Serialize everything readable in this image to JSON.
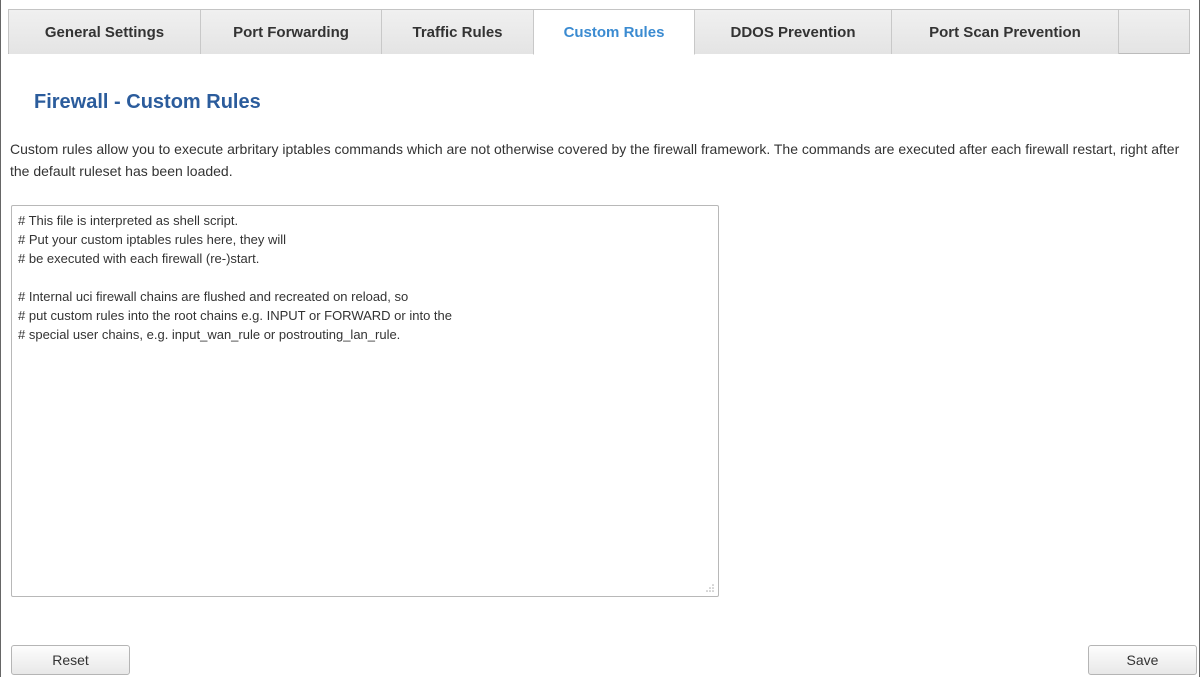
{
  "tabs": [
    {
      "label": "General Settings",
      "active": false
    },
    {
      "label": "Port Forwarding",
      "active": false
    },
    {
      "label": "Traffic Rules",
      "active": false
    },
    {
      "label": "Custom Rules",
      "active": true
    },
    {
      "label": "DDOS Prevention",
      "active": false
    },
    {
      "label": "Port Scan Prevention",
      "active": false
    }
  ],
  "page": {
    "title": "Firewall - Custom Rules",
    "description": "Custom rules allow you to execute arbritary iptables commands which are not otherwise covered by the firewall framework. The commands are executed after each firewall restart, right after the default ruleset has been loaded."
  },
  "editor": {
    "lines": [
      "# This file is interpreted as shell script.",
      "# Put your custom iptables rules here, they will",
      "# be executed with each firewall (re-)start.",
      "",
      "# Internal uci firewall chains are flushed and recreated on reload, so",
      "# put custom rules into the root chains e.g. INPUT or FORWARD or into the",
      "# special user chains, e.g. input_wan_rule or postrouting_lan_rule."
    ]
  },
  "buttons": {
    "reset_label": "Reset",
    "save_label": "Save"
  },
  "colors": {
    "active_tab_text": "#3b8bd1",
    "title_text": "#2b5c9c"
  }
}
